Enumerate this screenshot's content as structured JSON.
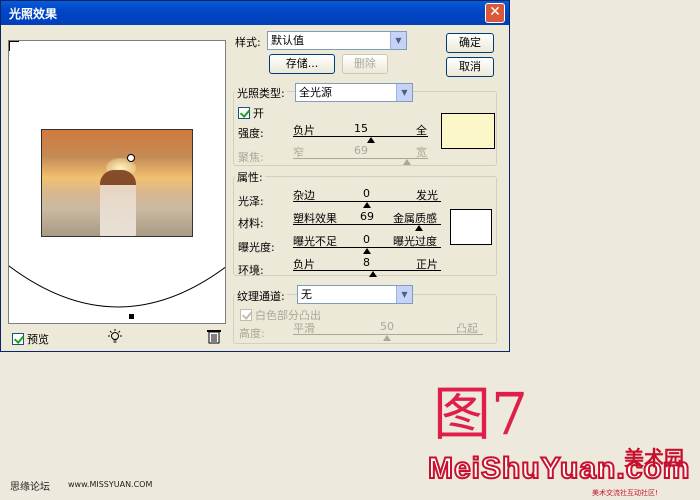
{
  "dialog": {
    "title": "光照效果",
    "close_glyph": "✕"
  },
  "style_row": {
    "label": "样式:",
    "value": "默认值",
    "save_label": "存储...",
    "delete_label": "删除"
  },
  "buttons": {
    "ok": "确定",
    "cancel": "取消"
  },
  "light_type": {
    "label": "光照类型:",
    "value": "全光源",
    "on_label": "开",
    "on_checked": true,
    "intensity": {
      "label": "强度:",
      "left": "负片",
      "value": "15",
      "right": "全"
    },
    "focus": {
      "label": "聚焦:",
      "left": "窄",
      "value": "69",
      "right": "宽"
    },
    "swatch_color": "#fbf7c8"
  },
  "properties": {
    "title": "属性:",
    "gloss": {
      "label": "光泽:",
      "left": "杂边",
      "value": "0",
      "right": "发光"
    },
    "material": {
      "label": "材料:",
      "left": "塑料效果",
      "value": "69",
      "right": "金属质感"
    },
    "exposure": {
      "label": "曝光度:",
      "left": "曝光不足",
      "value": "0",
      "right": "曝光过度"
    },
    "ambience": {
      "label": "环境:",
      "left": "负片",
      "value": "8",
      "right": "正片"
    },
    "swatch_color": "#ffffff"
  },
  "texture": {
    "label": "纹理通道:",
    "value": "无",
    "white_high_label": "白色部分凸出",
    "white_high_checked": true,
    "height": {
      "label": "高度:",
      "left": "平滑",
      "value": "50",
      "right": "凸起"
    }
  },
  "preview": {
    "label": "预览",
    "checked": true
  },
  "figure_label": "图7",
  "footer": {
    "forum": "思缘论坛",
    "url": "www.MISSYUAN.COM"
  },
  "brand": {
    "name": "MeiShuYuan.com",
    "cn": "美术园",
    "sub": "美术交流社互动社区!"
  }
}
